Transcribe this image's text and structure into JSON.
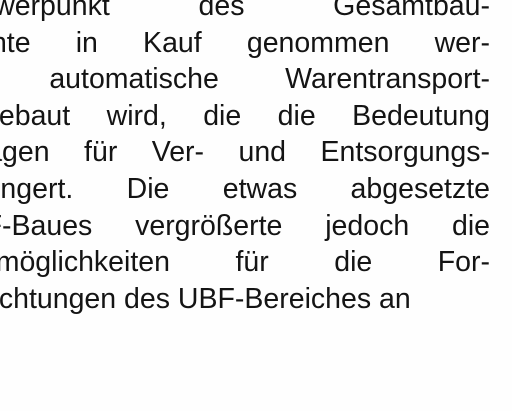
{
  "document": {
    "lines": [
      "Schwerpunkt des Gesamtbau-",
      "konnte in Kauf genommen wer-",
      "die automatische Warentransport-",
      "eingebaut wird, die die Bedeutung",
      "Anlagen für Ver- und Entsorgungs-",
      "verringert. Die etwas abgesetzte",
      "UBF-Baues vergrößerte jedoch die",
      "Baumöglichkeiten   für   die   For-",
      "einrichtungen des UBF-Bereiches an"
    ]
  }
}
